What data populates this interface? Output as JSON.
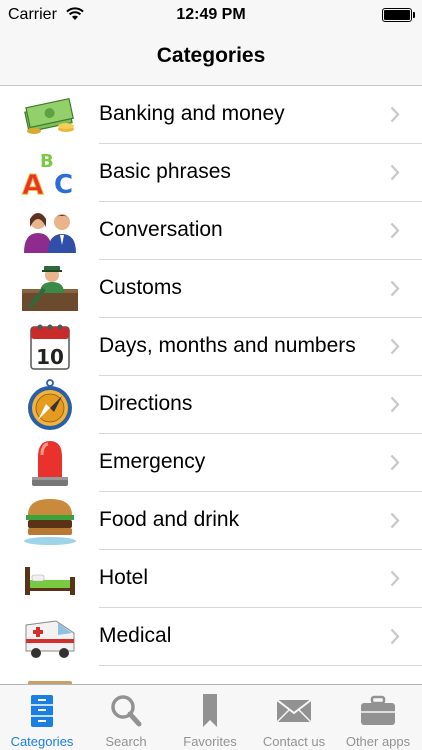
{
  "status_bar": {
    "carrier": "Carrier",
    "time": "12:49 PM"
  },
  "nav": {
    "title": "Categories"
  },
  "categories": [
    {
      "label": "Banking and money",
      "icon": "money-icon"
    },
    {
      "label": "Basic phrases",
      "icon": "abc-blocks-icon"
    },
    {
      "label": "Conversation",
      "icon": "people-icon"
    },
    {
      "label": "Customs",
      "icon": "customs-officer-icon"
    },
    {
      "label": "Days, months and numbers",
      "icon": "calendar-icon"
    },
    {
      "label": "Directions",
      "icon": "compass-icon"
    },
    {
      "label": "Emergency",
      "icon": "siren-icon"
    },
    {
      "label": "Food and drink",
      "icon": "burger-icon"
    },
    {
      "label": "Hotel",
      "icon": "bed-icon"
    },
    {
      "label": "Medical",
      "icon": "ambulance-icon"
    }
  ],
  "tabs": [
    {
      "label": "Categories",
      "icon": "categories-icon",
      "active": true
    },
    {
      "label": "Search",
      "icon": "search-icon",
      "active": false
    },
    {
      "label": "Favorites",
      "icon": "bookmark-icon",
      "active": false
    },
    {
      "label": "Contact us",
      "icon": "envelope-icon",
      "active": false
    },
    {
      "label": "Other apps",
      "icon": "briefcase-icon",
      "active": false
    }
  ],
  "colors": {
    "accent": "#1a7fe2",
    "inactive": "#929292"
  }
}
